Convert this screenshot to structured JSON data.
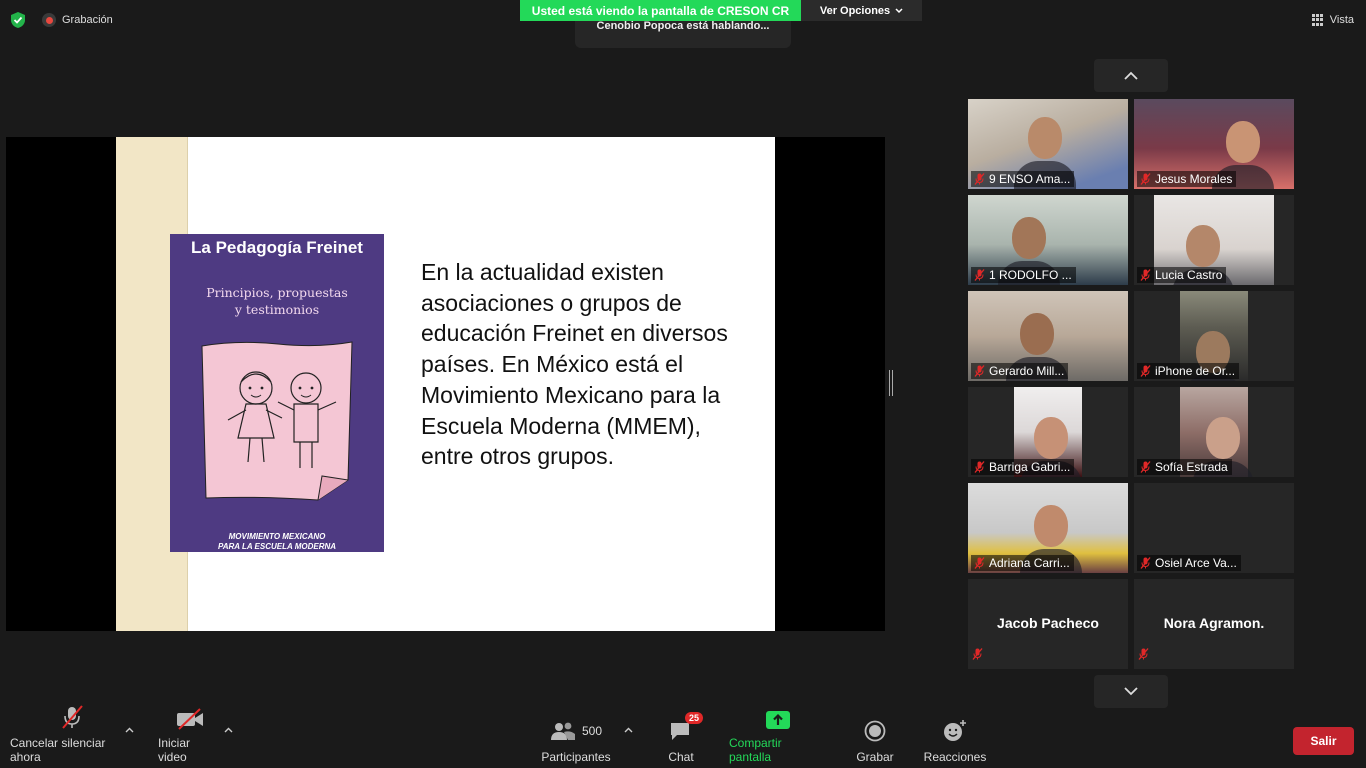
{
  "top_bar": {
    "recording_label": "Grabación",
    "share_banner": "Usted está viendo la pantalla de CRESON CR",
    "view_options_label": "Ver Opciones",
    "speaking_label": "Cenobio Popoca está hablando...",
    "view_label": "Vista"
  },
  "slide": {
    "book_title": "La Pedagogía Freinet",
    "book_subtitle_line1": "Principios, propuestas",
    "book_subtitle_line2": "y testimonios",
    "book_footer_line1": "MOVIMIENTO MEXICANO",
    "book_footer_line2": "PARA LA ESCUELA MODERNA",
    "body_text": "En la actualidad existen asociaciones o grupos de educación Freinet en diversos países. En México está el Movimiento Mexicano para la Escuela Moderna (MMEM), entre otros grupos."
  },
  "participants": [
    {
      "name": "9 ENSO Ama..."
    },
    {
      "name": "Jesus Morales"
    },
    {
      "name": "1 RODOLFO ..."
    },
    {
      "name": "Lucia Castro"
    },
    {
      "name": "Gerardo Mill..."
    },
    {
      "name": "iPhone de Or..."
    },
    {
      "name": "Barriga Gabri..."
    },
    {
      "name": "Sofía Estrada"
    },
    {
      "name": "Adriana Carri..."
    },
    {
      "name": "Osiel Arce Va..."
    },
    {
      "name": "Jacob Pacheco"
    },
    {
      "name": "Nora Agramon."
    }
  ],
  "toolbar": {
    "mute_label": "Cancelar silenciar ahora",
    "video_label": "Iniciar video",
    "participants_label": "Participantes",
    "participants_count": "500",
    "chat_label": "Chat",
    "chat_badge": "25",
    "share_label": "Compartir pantalla",
    "record_label": "Grabar",
    "reactions_label": "Reacciones",
    "leave_label": "Salir"
  },
  "colors": {
    "share_green": "#23d959",
    "leave_red": "#c3242e",
    "book_purple": "#4e3a82",
    "mic_off_red": "#e02828"
  }
}
